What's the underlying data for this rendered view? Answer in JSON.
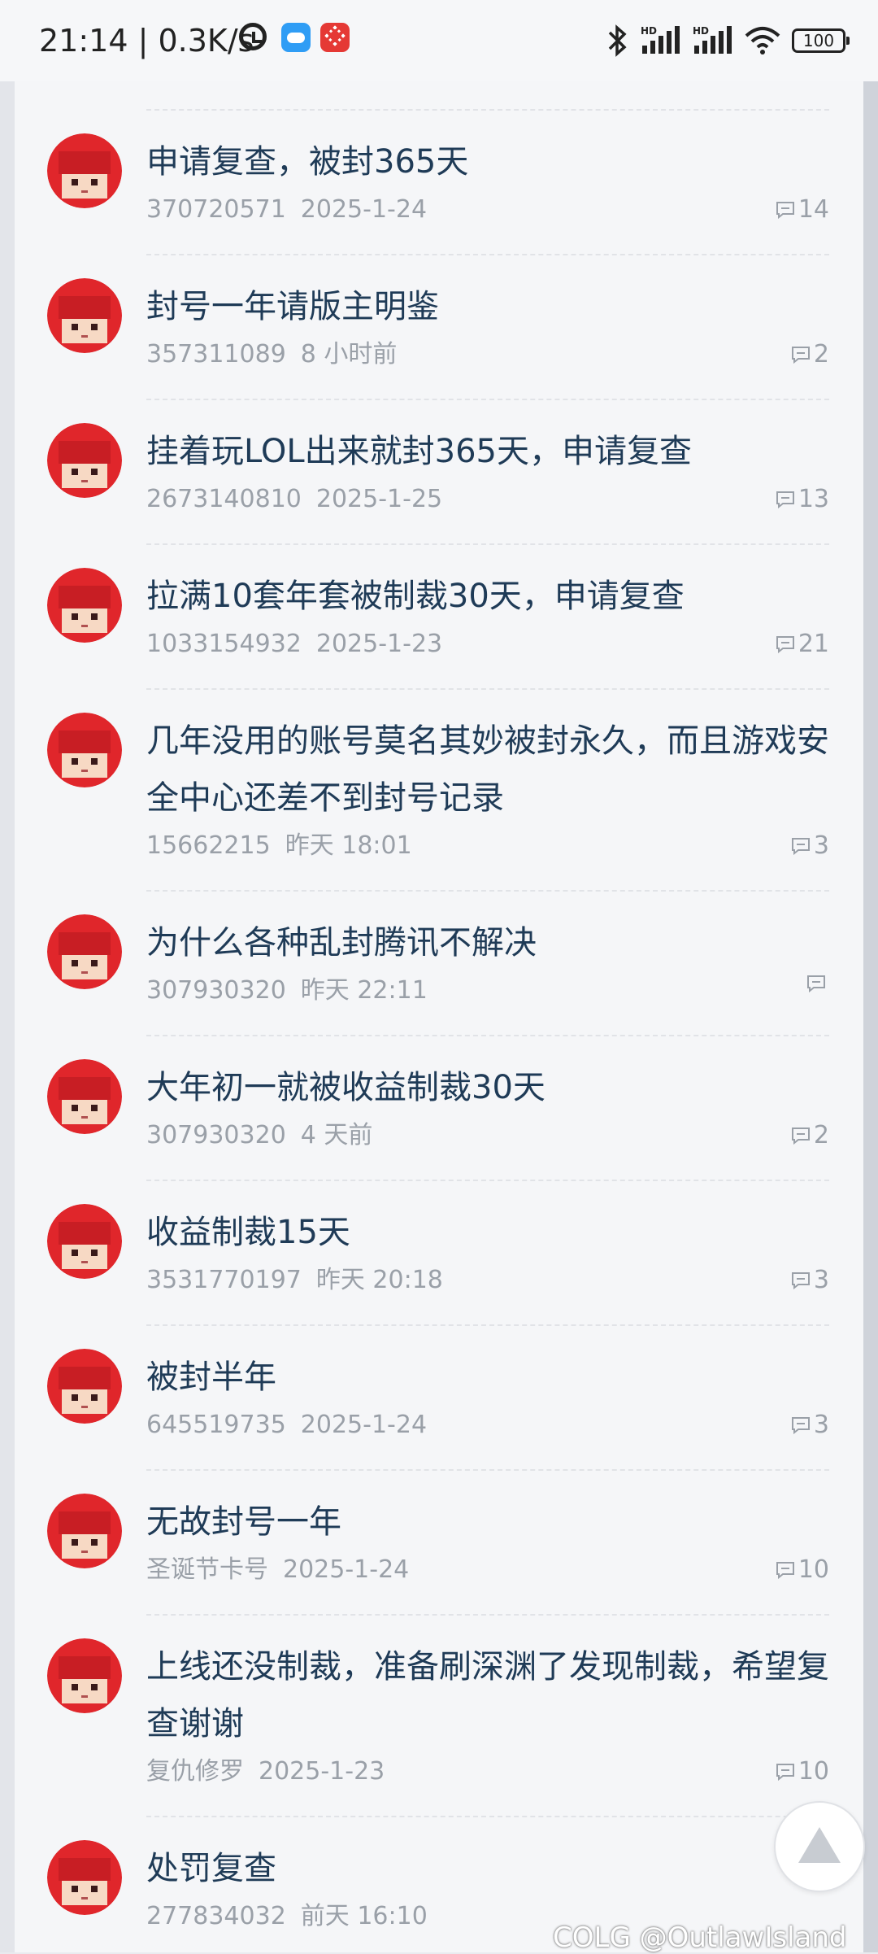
{
  "status_bar": {
    "time_speed": "21:14 | 0.3K/s",
    "battery": "100"
  },
  "posts": [
    {
      "title": "申请复查，被封365天",
      "author": "370720571",
      "time": "2025-1-24",
      "comments": "14"
    },
    {
      "title": "封号一年请版主明鉴",
      "author": "357311089",
      "time": "8 小时前",
      "comments": "2"
    },
    {
      "title": "挂着玩LOL出来就封365天，申请复查",
      "author": "2673140810",
      "time": "2025-1-25",
      "comments": "13"
    },
    {
      "title": "拉满10套年套被制裁30天，申请复查",
      "author": "1033154932",
      "time": "2025-1-23",
      "comments": "21"
    },
    {
      "title": "几年没用的账号莫名其妙被封永久，而且游戏安全中心还差不到封号记录",
      "author": "15662215",
      "time": "昨天 18:01",
      "comments": "3"
    },
    {
      "title": "为什么各种乱封腾讯不解决",
      "author": "307930320",
      "time": "昨天 22:11",
      "comments": ""
    },
    {
      "title": "大年初一就被收益制裁30天",
      "author": "307930320",
      "time": "4 天前",
      "comments": "2"
    },
    {
      "title": "收益制裁15天",
      "author": "3531770197",
      "time": "昨天 20:18",
      "comments": "3"
    },
    {
      "title": "被封半年",
      "author": "645519735",
      "time": "2025-1-24",
      "comments": "3"
    },
    {
      "title": "无故封号一年",
      "author": "圣诞节卡号",
      "time": "2025-1-24",
      "comments": "10"
    },
    {
      "title": "上线还没制裁，准备刷深渊了发现制裁，希望复查谢谢",
      "author": "复仇修罗",
      "time": "2025-1-23",
      "comments": "10"
    },
    {
      "title": "处罚复查",
      "author": "277834032",
      "time": "前天 16:10",
      "comments": ""
    }
  ],
  "watermark": "@OutlawIsland",
  "watermark_logo": "COLG",
  "colors": {
    "title": "#1f3b57",
    "meta": "#9aa0a8",
    "avatar": "#e0262b"
  }
}
